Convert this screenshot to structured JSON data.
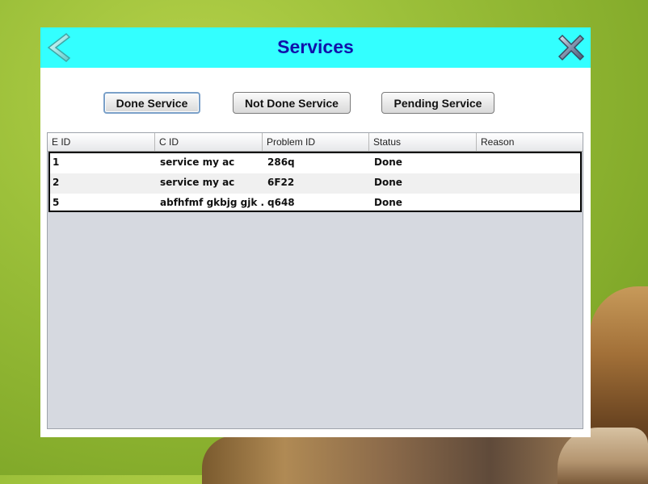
{
  "window": {
    "title": "Services"
  },
  "buttons": {
    "done": "Done Service",
    "not_done": "Not Done Service",
    "pending": "Pending Service"
  },
  "table": {
    "columns": [
      "E ID",
      "C ID",
      "Problem ID",
      "Status",
      "Reason"
    ],
    "rows": [
      [
        "1",
        "service my ac",
        "286q",
        "Done",
        ""
      ],
      [
        "2",
        "service my ac",
        "6F22",
        "Done",
        ""
      ],
      [
        "5",
        "abfhfmf gkbjg gjk ...",
        "q648",
        "Done",
        ""
      ]
    ]
  },
  "colors": {
    "titlebar": "#33ffff",
    "title_text": "#1111aa",
    "table_bg": "#d6d9e0"
  },
  "icons": {
    "back": "back-arrow-icon",
    "close": "close-x-icon"
  }
}
